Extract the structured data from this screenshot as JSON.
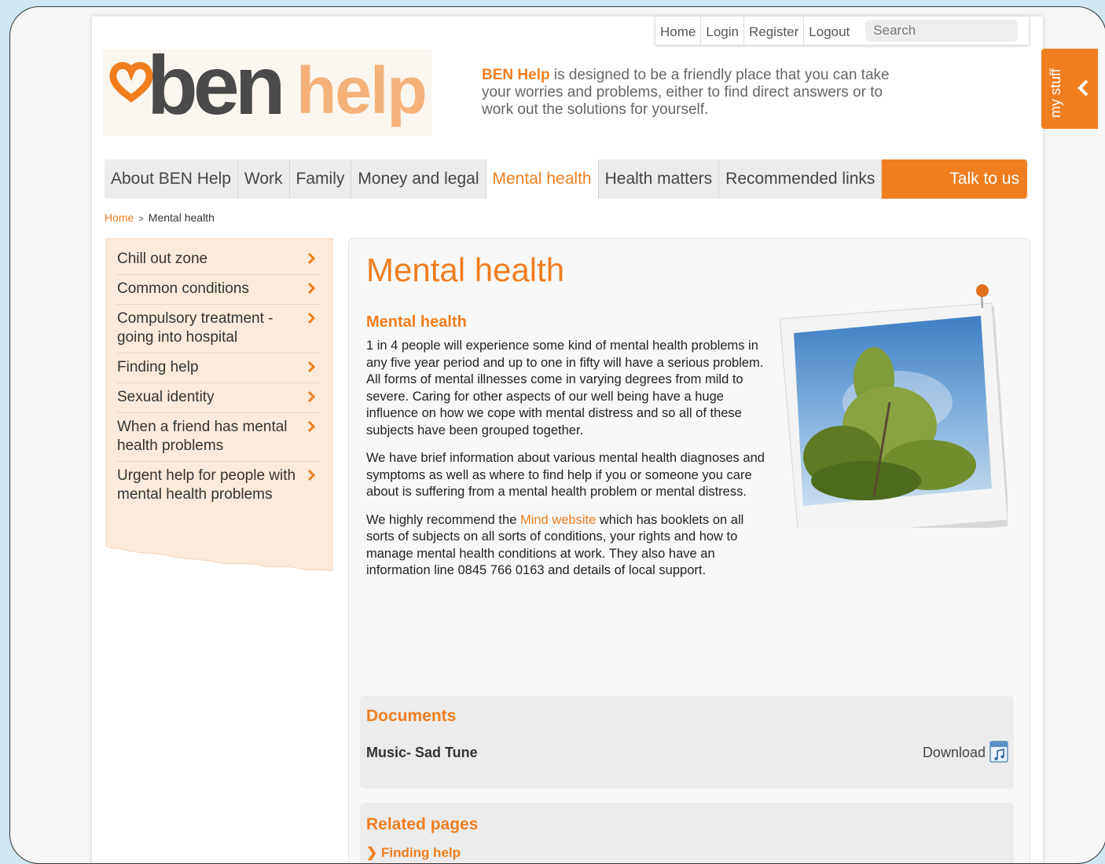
{
  "topnav": {
    "items": [
      "Home",
      "Login",
      "Register",
      "Logout"
    ],
    "search_placeholder": "Search"
  },
  "logo": {
    "ben": "ben",
    "help": "help"
  },
  "intro": {
    "brand": "BEN Help",
    "text": " is designed to be a friendly place that you can take your worries and problems, either to find direct answers or to work out the solutions for yourself."
  },
  "mystuff": {
    "label": "my stuff"
  },
  "mainnav": {
    "items": [
      "About BEN Help",
      "Work",
      "Family",
      "Money and legal",
      "Mental health",
      "Health matters",
      "Recommended links"
    ],
    "active": "Mental health",
    "talk": "Talk to us"
  },
  "breadcrumb": {
    "home": "Home",
    "sep": ">",
    "current": "Mental health"
  },
  "sidebar": {
    "items": [
      "Chill out zone",
      "Common conditions",
      "Compulsory treatment - going into hospital",
      "Finding help",
      "Sexual identity",
      "When a friend has mental health problems",
      "Urgent help for people with mental health problems"
    ]
  },
  "content": {
    "title": "Mental health",
    "subtitle": "Mental health",
    "p1": "1 in 4 people will experience some kind of mental health problems in any five year period and up to one in fifty will have a serious problem. All forms of mental illnesses come in varying degrees from mild to severe. Caring for other aspects of our well being have a huge influence on how we cope with mental distress and so all of these subjects have been grouped together.",
    "p2": "We have brief information about various mental health diagnoses and symptoms as well as where to find help if you or someone you care about is suffering from a mental health problem or mental distress.",
    "p3_before": "We highly recommend the ",
    "p3_link": "Mind website",
    "p3_after": " which has booklets on all sorts of subjects on all sorts of conditions, your rights and how to manage mental health conditions at work. They also have an information line 0845 766 0163 and details of local support."
  },
  "documents": {
    "title": "Documents",
    "name": "Music- Sad Tune",
    "download": "Download"
  },
  "related": {
    "title": "Related pages",
    "link": "Finding help"
  },
  "colors": {
    "accent": "#f07e1f",
    "sidebar_bg": "#fdeadb",
    "nav_bg": "#ececec"
  }
}
